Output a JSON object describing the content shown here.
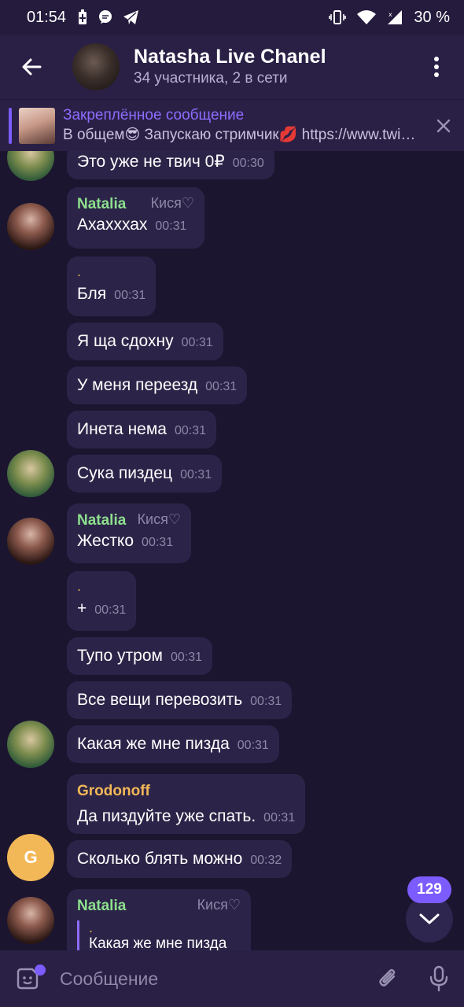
{
  "status_bar": {
    "time": "01:54",
    "battery": "30 %"
  },
  "header": {
    "title": "Natasha Live Chanel",
    "subtitle": "34 участника, 2 в сети"
  },
  "pinned": {
    "title": "Закреплённое сообщение",
    "text": "В общем😎  Запускаю стримчик💋  https://www.twitch.tv/"
  },
  "messages": [
    {
      "text": "Это уже не твич 0₽",
      "time": "00:30"
    },
    {
      "sender": "Natalia",
      "role": "Кися♡",
      "text": "Ахахххах",
      "time": "00:31"
    },
    {
      "dot": ".",
      "text": "Бля",
      "time": "00:31"
    },
    {
      "text": "Я ща сдохну",
      "time": "00:31"
    },
    {
      "text": "У меня переезд",
      "time": "00:31"
    },
    {
      "text": "Инета нема",
      "time": "00:31"
    },
    {
      "text": "Сука пиздец",
      "time": "00:31"
    },
    {
      "sender": "Natalia",
      "role": "Кися♡",
      "text": "Жестко",
      "time": "00:31"
    },
    {
      "dot": ".",
      "text": "+",
      "time": "00:31"
    },
    {
      "text": "Тупо утром",
      "time": "00:31"
    },
    {
      "text": "Все вещи перевозить",
      "time": "00:31"
    },
    {
      "text": "Какая же мне пизда",
      "time": "00:31"
    },
    {
      "sender": "Grodonoff",
      "text": "Да пиздуйте уже спать.",
      "time": "00:31"
    },
    {
      "text": "Сколько блять можно",
      "time": "00:32"
    },
    {
      "sender": "Natalia",
      "role": "Кися♡",
      "quote_dot": ".",
      "quote_text": "Какая же мне пизда"
    }
  ],
  "avatar_letter": "G",
  "unread_count": "129",
  "input": {
    "placeholder": "Сообщение"
  },
  "colors": {
    "background": "#1c1530",
    "header": "#2a2046",
    "bubble": "#2c2448",
    "accent": "#7c5cff",
    "sender_natalia": "#8de08d",
    "sender_grodonoff": "#f2b857"
  }
}
